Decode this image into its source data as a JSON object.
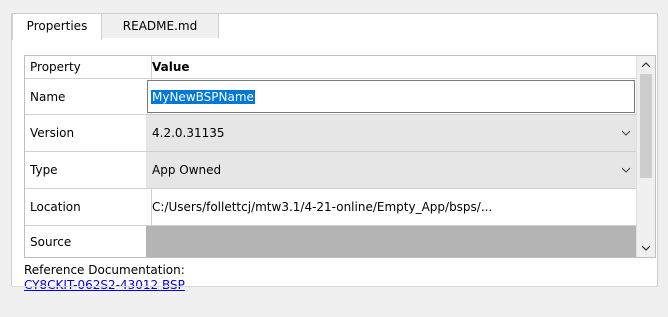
{
  "tabs": [
    {
      "label": "Properties",
      "active": true
    },
    {
      "label": "README.md",
      "active": false
    }
  ],
  "grid": {
    "header": {
      "property": "Property",
      "value": "Value"
    },
    "rows": [
      {
        "property": "Name",
        "value": "MyNewBSPName",
        "editing": true
      },
      {
        "property": "Version",
        "value": "4.2.0.31135",
        "dropdown": true
      },
      {
        "property": "Type",
        "value": "App Owned",
        "dropdown": true
      },
      {
        "property": "Location",
        "value": "C:/Users/follettcj/mtw3.1/4-21-online/Empty_App/bsps/..."
      },
      {
        "property": "Source",
        "value": ""
      }
    ]
  },
  "reference": {
    "label": "Reference Documentation:",
    "link": "CY8CKIT-062S2-43012 BSP"
  },
  "colors": {
    "selection": "#0078d7",
    "link": "#0000ee",
    "disabled_cell": "#e6e6e6"
  },
  "icons": [
    "chevron-down-icon",
    "scroll-up-icon",
    "scroll-down-icon"
  ]
}
